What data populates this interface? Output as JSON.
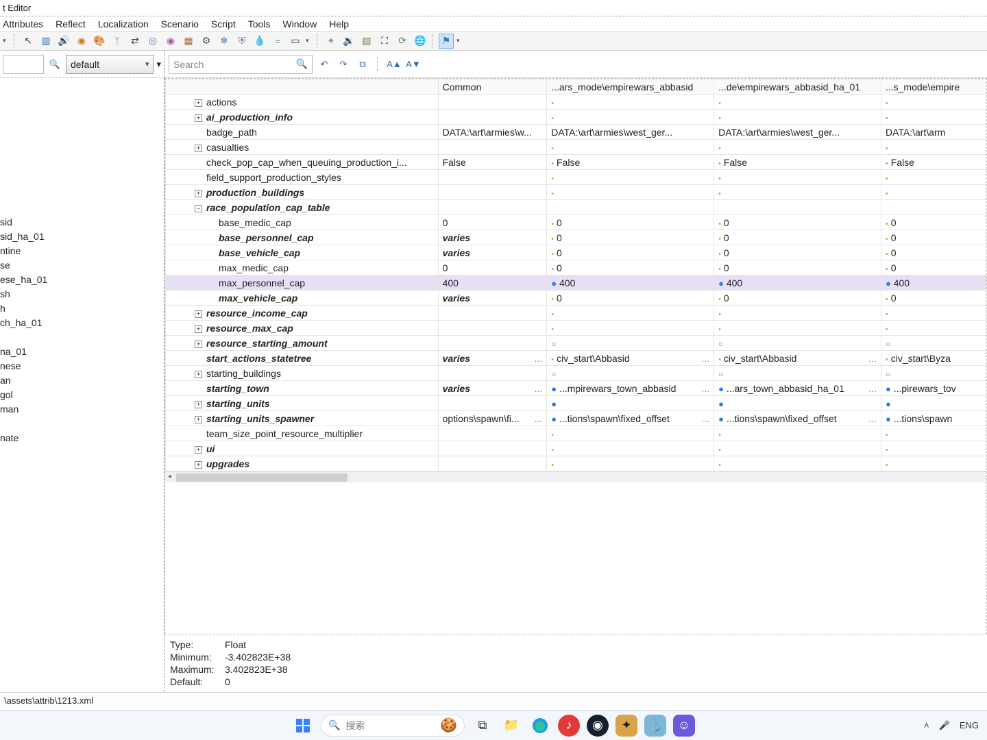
{
  "window": {
    "title": "t Editor"
  },
  "menus": [
    "Attributes",
    "Reflect",
    "Localization",
    "Scenario",
    "Script",
    "Tools",
    "Window",
    "Help"
  ],
  "left": {
    "combo": "default",
    "items": [
      "sid",
      "sid_ha_01",
      "ntine",
      "se",
      "ese_ha_01",
      "sh",
      "h",
      "ch_ha_01",
      "",
      "na_01",
      "nese",
      "an",
      "gol",
      "man",
      "",
      "nate"
    ]
  },
  "search": {
    "placeholder": "Search"
  },
  "columns": [
    "",
    "Common",
    "...ars_mode\\empirewars_abbasid",
    "...de\\empirewars_abbasid_ha_01",
    "...s_mode\\empire"
  ],
  "rows": [
    {
      "ind": 2,
      "exp": "+",
      "label": "actions",
      "cells": [
        "",
        "·",
        "·",
        "·"
      ]
    },
    {
      "ind": 2,
      "exp": "+",
      "label": "ai_production_info",
      "cls": "bolditalic",
      "cells": [
        "",
        "·",
        "·",
        "·"
      ]
    },
    {
      "ind": 2,
      "exp": "",
      "label": "badge_path",
      "cells": [
        "DATA:\\art\\armies\\w...",
        "DATA:\\art\\armies\\west_ger...",
        "DATA:\\art\\armies\\west_ger...",
        "DATA:\\art\\arm"
      ]
    },
    {
      "ind": 2,
      "exp": "+",
      "label": "casualties",
      "cells": [
        "",
        "·",
        "·",
        "·"
      ]
    },
    {
      "ind": 2,
      "exp": "",
      "label": "check_pop_cap_when_queuing_production_i...",
      "cells": [
        "False",
        "· False",
        "· False",
        "· False"
      ]
    },
    {
      "ind": 2,
      "exp": "",
      "label": "field_support_production_styles",
      "cells": [
        "",
        "·",
        "·",
        "·"
      ]
    },
    {
      "ind": 2,
      "exp": "+",
      "label": "production_buildings",
      "cls": "bolditalic",
      "cells": [
        "",
        "·",
        "·",
        "·"
      ]
    },
    {
      "ind": 2,
      "exp": "−",
      "label": "race_population_cap_table",
      "cls": "bolditalic",
      "cells": [
        "",
        "",
        "",
        ""
      ]
    },
    {
      "ind": 3,
      "exp": "",
      "label": "base_medic_cap",
      "cells": [
        "0",
        "· 0",
        "· 0",
        "· 0"
      ]
    },
    {
      "ind": 3,
      "exp": "",
      "label": "base_personnel_cap",
      "cls": "bolditalic",
      "cells": [
        "varies",
        "· 0",
        "· 0",
        "· 0"
      ],
      "commonItalic": true
    },
    {
      "ind": 3,
      "exp": "",
      "label": "base_vehicle_cap",
      "cls": "bolditalic",
      "cells": [
        "varies",
        "· 0",
        "· 0",
        "· 0"
      ],
      "commonItalic": true
    },
    {
      "ind": 3,
      "exp": "",
      "label": "max_medic_cap",
      "cells": [
        "0",
        "· 0",
        "· 0",
        "· 0"
      ]
    },
    {
      "ind": 3,
      "exp": "",
      "label": "max_personnel_cap",
      "selected": true,
      "cells": [
        "400",
        "● 400",
        "● 400",
        "● 400"
      ]
    },
    {
      "ind": 3,
      "exp": "",
      "label": "max_vehicle_cap",
      "cls": "bolditalic",
      "cells": [
        "varies",
        "· 0",
        "· 0",
        "· 0"
      ],
      "commonItalic": true
    },
    {
      "ind": 2,
      "exp": "+",
      "label": "resource_income_cap",
      "cls": "bolditalic",
      "cells": [
        "",
        "·",
        "·",
        "·"
      ]
    },
    {
      "ind": 2,
      "exp": "+",
      "label": "resource_max_cap",
      "cls": "bolditalic",
      "cells": [
        "",
        "·",
        "·",
        "·"
      ]
    },
    {
      "ind": 2,
      "exp": "+",
      "label": "resource_starting_amount",
      "cls": "bolditalic",
      "cells": [
        "",
        "○",
        "○",
        "○"
      ]
    },
    {
      "ind": 2,
      "exp": "",
      "label": "start_actions_statetree",
      "cls": "bolditalic",
      "cells": [
        "varies",
        "· civ_start\\Abbasid",
        "· civ_start\\Abbasid",
        "· civ_start\\Byza"
      ],
      "commonItalic": true,
      "ellips": true
    },
    {
      "ind": 2,
      "exp": "+",
      "label": "starting_buildings",
      "cells": [
        "",
        "○",
        "○",
        "○"
      ]
    },
    {
      "ind": 2,
      "exp": "",
      "label": "starting_town",
      "cls": "bolditalic",
      "cells": [
        "varies",
        "● ...mpirewars_town_abbasid",
        "● ...ars_town_abbasid_ha_01",
        "● ...pirewars_tov"
      ],
      "commonItalic": true,
      "ellips": true
    },
    {
      "ind": 2,
      "exp": "+",
      "label": "starting_units",
      "cls": "bolditalic",
      "cells": [
        "",
        "●",
        "●",
        "●"
      ]
    },
    {
      "ind": 2,
      "exp": "+",
      "label": "starting_units_spawner",
      "cls": "bolditalic",
      "cells": [
        "options\\spawn\\fi...",
        "● ...tions\\spawn\\fixed_offset",
        "● ...tions\\spawn\\fixed_offset",
        "● ...tions\\spawn"
      ],
      "ellips": true
    },
    {
      "ind": 2,
      "exp": "",
      "label": "team_size_point_resource_multiplier",
      "cells": [
        "",
        "·",
        "·",
        "·"
      ]
    },
    {
      "ind": 2,
      "exp": "+",
      "label": "ui",
      "cls": "bolditalic",
      "cells": [
        "",
        "·",
        "·",
        "·"
      ]
    },
    {
      "ind": 2,
      "exp": "+",
      "label": "upgrades",
      "cls": "bolditalic",
      "cells": [
        "",
        "·",
        "·",
        "·"
      ]
    }
  ],
  "details": {
    "type_label": "Type:",
    "type": "Float",
    "min_label": "Minimum:",
    "min": "-3.402823E+38",
    "max_label": "Maximum:",
    "max": "3.402823E+38",
    "def_label": "Default:",
    "def": "0"
  },
  "status": "\\assets\\attrib\\1213.xml",
  "taskbar": {
    "search_placeholder": "搜索",
    "lang": "ENG"
  }
}
